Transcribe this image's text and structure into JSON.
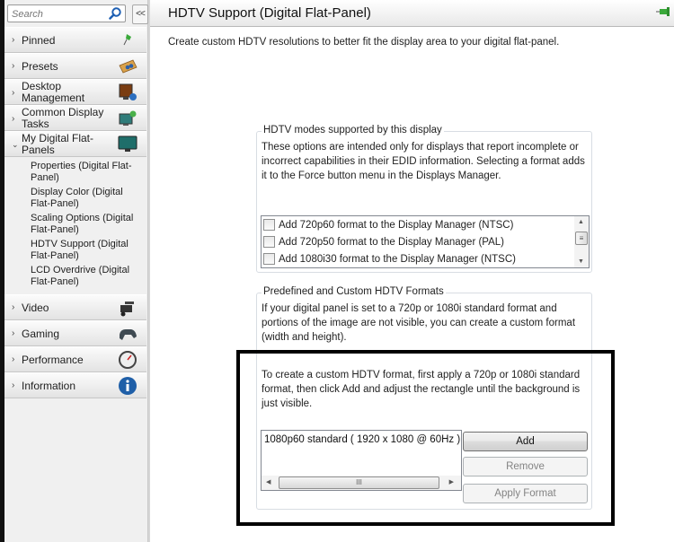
{
  "sidebar": {
    "search": {
      "placeholder": "Search",
      "value": "",
      "icon": "search-icon"
    },
    "collapse_label": "<<",
    "items": [
      {
        "label": "Pinned",
        "icon": "pushpin-icon",
        "expanded": false
      },
      {
        "label": "Presets",
        "icon": "presets-icon",
        "expanded": false
      },
      {
        "label": "Desktop Management",
        "icon": "desktop-management-icon",
        "expanded": false
      },
      {
        "label": "Common Display Tasks",
        "icon": "display-tasks-icon",
        "expanded": false
      },
      {
        "label": "My Digital Flat-Panels",
        "icon": "monitor-icon",
        "expanded": true,
        "children": [
          "Properties (Digital Flat-Panel)",
          "Display Color (Digital Flat-Panel)",
          "Scaling Options (Digital Flat-Panel)",
          "HDTV Support (Digital Flat-Panel)",
          "LCD Overdrive (Digital Flat-Panel)"
        ]
      },
      {
        "label": "Video",
        "icon": "video-camera-icon",
        "expanded": false
      },
      {
        "label": "Gaming",
        "icon": "gamepad-icon",
        "expanded": false
      },
      {
        "label": "Performance",
        "icon": "gauge-icon",
        "expanded": false
      },
      {
        "label": "Information",
        "icon": "info-icon",
        "expanded": false
      }
    ]
  },
  "header": {
    "title": "HDTV Support (Digital Flat-Panel)",
    "pin_icon": "pushpin-icon"
  },
  "main": {
    "description": "Create custom HDTV resolutions to better fit the display area to your digital flat-panel.",
    "modes_group": {
      "legend": "HDTV modes supported by this display",
      "text": "These options are intended only for displays that report incomplete or incorrect capabilities in their EDID information. Selecting a format adds it to the Force button menu in the Displays Manager.",
      "options": [
        {
          "label": "Add 720p60 format to the Display Manager (NTSC)",
          "checked": false
        },
        {
          "label": "Add 720p50 format to the Display Manager (PAL)",
          "checked": false
        },
        {
          "label": "Add 1080i30 format to the Display Manager (NTSC)",
          "checked": false
        }
      ]
    },
    "formats_group": {
      "legend": "Predefined and Custom HDTV Formats",
      "text1": "If your digital panel is set to a 720p or 1080i standard format and portions of the image are not visible, you can create a custom format (width and height).",
      "text2": "To create a custom HDTV format, first apply a 720p or 1080i standard format, then click Add and adjust the rectangle until the background is just visible.",
      "formats": [
        "1080p60 standard ( 1920 x 1080 @ 60Hz )"
      ],
      "buttons": {
        "add": "Add",
        "remove": "Remove",
        "apply": "Apply Format"
      }
    }
  },
  "colors": {
    "annotation_border": "#000000",
    "pin_green": "#3aa93a",
    "info_blue": "#1f5fa8"
  }
}
